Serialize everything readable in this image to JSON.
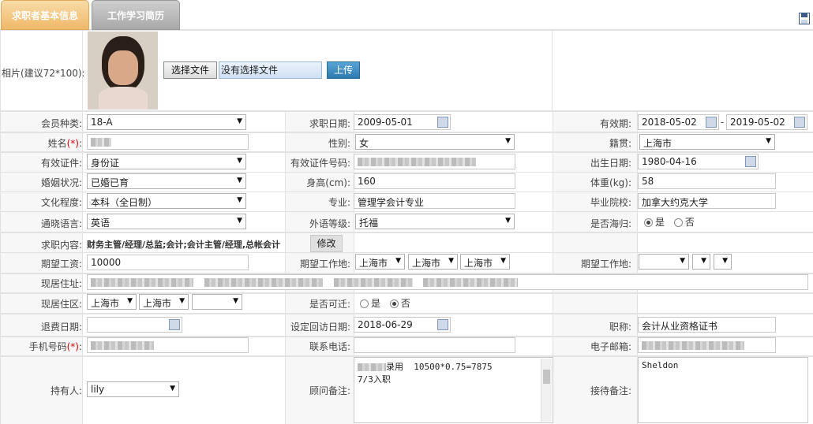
{
  "tabs": {
    "basic_info": "求职者基本信息",
    "work_study": "工作学习简历"
  },
  "photo": {
    "label": "相片(建议72*100):",
    "choose_file": "选择文件",
    "no_file": "没有选择文件",
    "upload": "上传"
  },
  "row_member": {
    "label": "会员种类:",
    "value": "18-A",
    "job_date_label": "求职日期:",
    "job_date": "2009-05-01",
    "valid_label": "有效期:",
    "valid_from": "2018-05-02",
    "sep": "-",
    "valid_to": "2019-05-02"
  },
  "row_name": {
    "label": "姓名",
    "req": "(*)",
    "colon": ":",
    "gender_label": "性别:",
    "gender": "女",
    "native_label": "籍贯:",
    "native": "上海市"
  },
  "row_id": {
    "label": "有效证件:",
    "value": "身份证",
    "idno_label": "有效证件号码:",
    "birth_label": "出生日期:",
    "birth": "1980-04-16"
  },
  "row_marriage": {
    "label": "婚姻状况:",
    "value": "已婚已育",
    "height_label": "身高(cm):",
    "height": "160",
    "weight_label": "体重(kg):",
    "weight": "58"
  },
  "row_edu": {
    "label": "文化程度:",
    "value": "本科（全日制）",
    "major_label": "专业:",
    "major": "管理学会计专业",
    "school_label": "毕业院校:",
    "school": "加拿大约克大学"
  },
  "row_lang": {
    "label": "通晓语言:",
    "value": "英语",
    "level_label": "外语等级:",
    "level": "托福",
    "overseas_label": "是否海归:",
    "yes": "是",
    "no": "否"
  },
  "row_job": {
    "label": "求职内容:",
    "value": "财务主管/经理/总监;会计;会计主管/经理,总帐会计",
    "edit": "修改"
  },
  "row_salary": {
    "label": "期望工资:",
    "value": "10000",
    "loc_label": "期望工作地:",
    "loc1": "上海市",
    "loc2": "上海市",
    "loc3": "上海市",
    "loc_label2": "期望工作地:"
  },
  "row_addr": {
    "label": "现居住址:"
  },
  "row_area": {
    "label": "现居住区:",
    "area1": "上海市",
    "area2": "上海市",
    "relocate_label": "是否可迁:",
    "yes": "是",
    "no": "否"
  },
  "row_refund": {
    "label": "退费日期:",
    "callback_label": "设定回访日期:",
    "callback": "2018-06-29",
    "title_label": "职称:",
    "title": "会计从业资格证书"
  },
  "row_phone": {
    "label": "手机号码",
    "req": "(*)",
    "colon": ":",
    "tel_label": "联系电话:",
    "email_label": "电子邮箱:"
  },
  "row_holder": {
    "label": "持有人:",
    "holder": "lily",
    "consult_label": "顾问备注:",
    "consult_line1": "录用  10500*0.75=7875",
    "consult_line2": "7/3入职",
    "reception_label": "接待备注:",
    "reception": "Sheldon"
  },
  "colors": {
    "tab_active": "#f0b868",
    "tab_inactive": "#a8a8a8",
    "upload_button": "#2e7bb0",
    "required": "#e00000"
  }
}
